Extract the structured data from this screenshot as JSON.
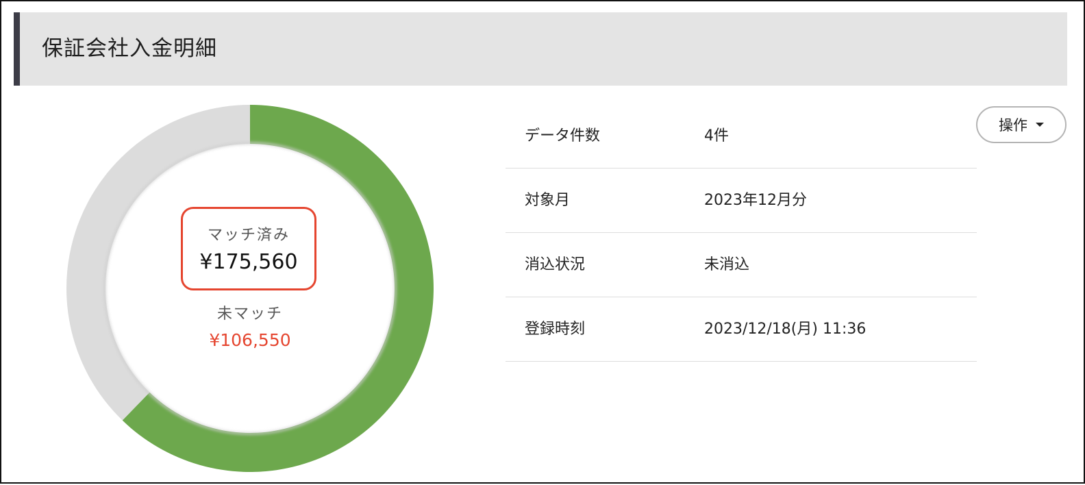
{
  "header": {
    "title": "保証会社入金明細"
  },
  "summary": {
    "matched_label": "マッチ済み",
    "matched_amount": "¥175,560",
    "unmatched_label": "未マッチ",
    "unmatched_amount": "¥106,550"
  },
  "colors": {
    "matched": "#6da84d",
    "unmatched": "#dcdcdc",
    "highlight": "#e5452f",
    "unmatched_text": "#e5452f"
  },
  "chart_data": {
    "type": "pie",
    "labels": [
      "マッチ済み",
      "未マッチ"
    ],
    "values": [
      175560,
      106550
    ],
    "title": ""
  },
  "actions": {
    "menu_label": "操作",
    "menu_icon": "caret-down-icon"
  },
  "info": [
    {
      "label": "データ件数",
      "value": "4件"
    },
    {
      "label": "対象月",
      "value": "2023年12月分"
    },
    {
      "label": "消込状況",
      "value": "未消込"
    },
    {
      "label": "登録時刻",
      "value": "2023/12/18(月) 11:36"
    }
  ]
}
